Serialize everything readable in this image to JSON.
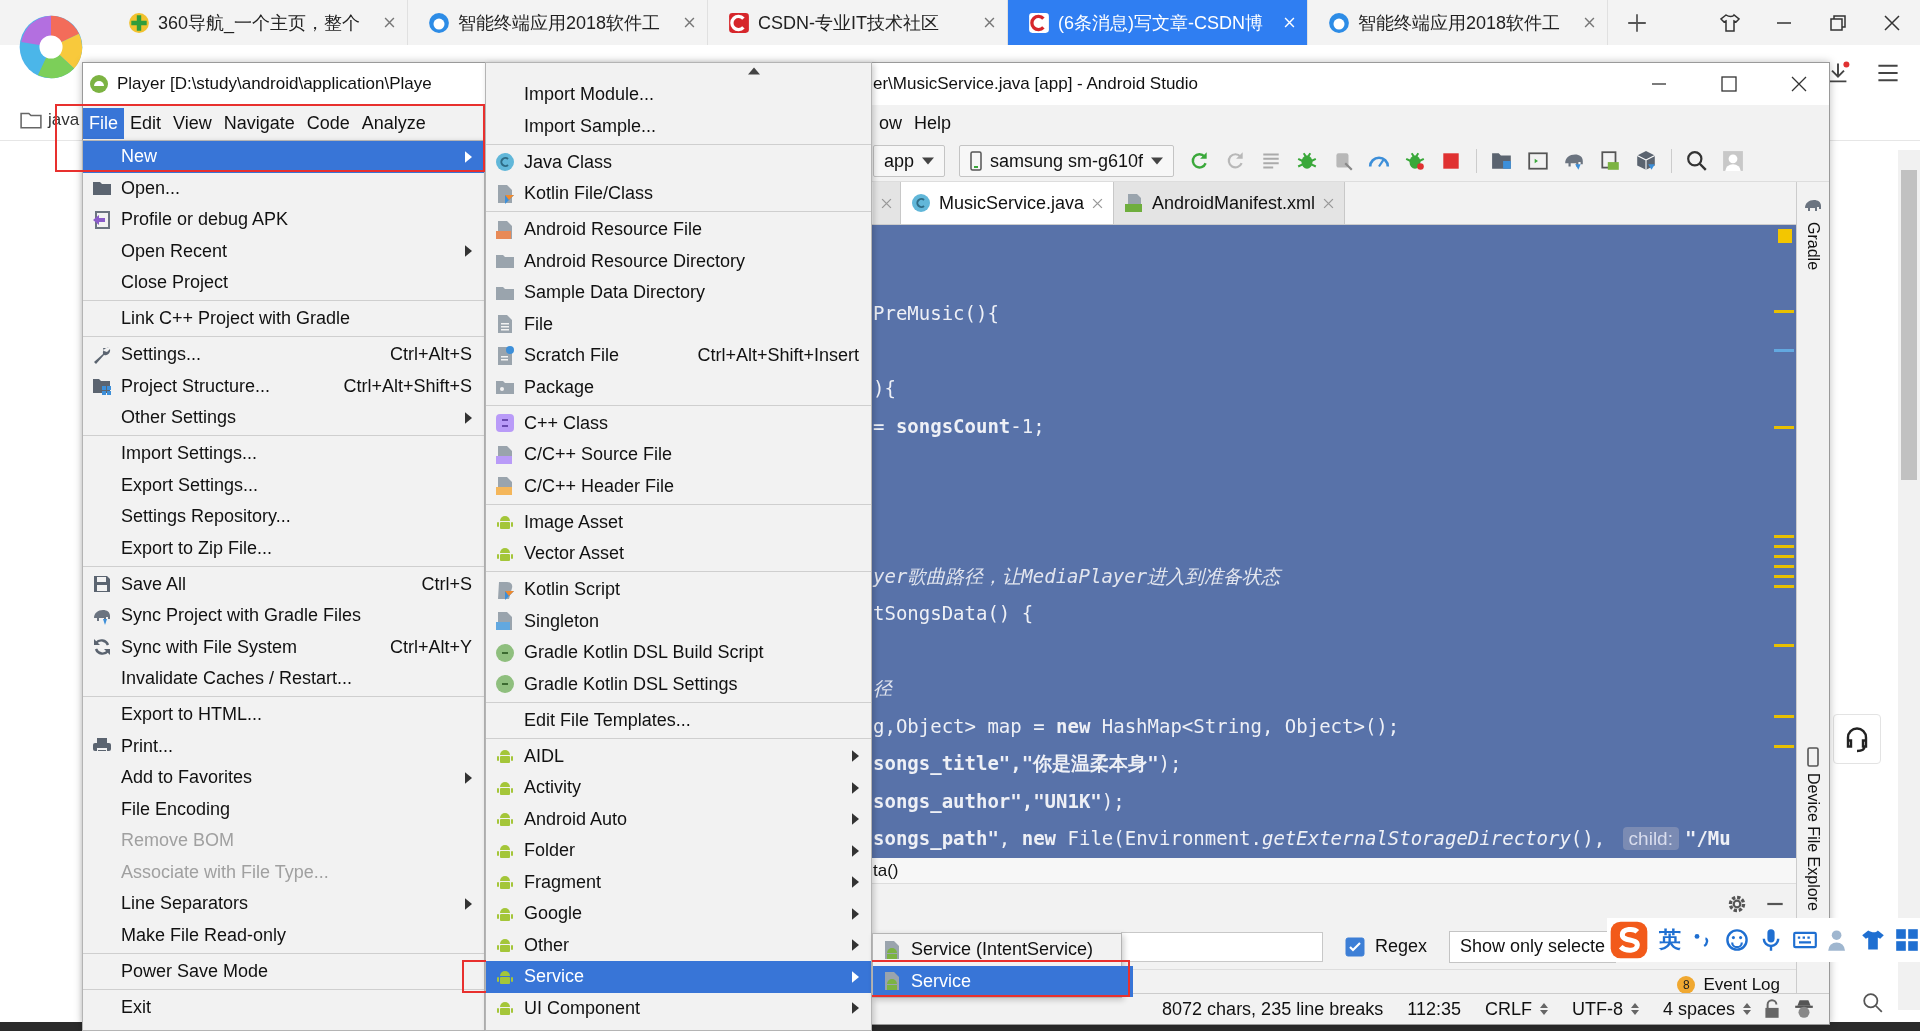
{
  "browser": {
    "tabs": [
      {
        "label": "360导航_一个主页，整个",
        "selected": false
      },
      {
        "label": "智能终端应用2018软件工",
        "selected": false
      },
      {
        "label": "CSDN-专业IT技术社区",
        "selected": false
      },
      {
        "label": "(6条消息)写文章-CSDN博",
        "selected": true
      },
      {
        "label": "智能终端应用2018软件工",
        "selected": false
      }
    ],
    "bookmark": "java"
  },
  "ide": {
    "title_left": "Player [D:\\study\\android\\application\\Playe",
    "title_right": "er\\MusicService.java [app] - Android Studio",
    "menubar": [
      {
        "label": "File",
        "selected": true
      },
      {
        "label": "Edit",
        "selected": false
      },
      {
        "label": "View",
        "selected": false
      },
      {
        "label": "Navigate",
        "selected": false
      },
      {
        "label": "Code",
        "selected": false
      },
      {
        "label": "Analyze",
        "selected": false
      }
    ],
    "menubar_right": [
      "ow",
      "Help"
    ],
    "run_config": "app",
    "device": "samsung sm-g610f",
    "editor_tabs": [
      {
        "label": "MusicService.java",
        "selected": true
      },
      {
        "label": "AndroidManifest.xml",
        "selected": false
      }
    ],
    "code_lines": [
      {
        "kind": "code",
        "text": "PreMusic(){"
      },
      {
        "kind": "blank"
      },
      {
        "kind": "code",
        "text": "){"
      },
      {
        "kind": "code",
        "text": "= **songsCount**-1;"
      },
      {
        "kind": "blank"
      },
      {
        "kind": "blank"
      },
      {
        "kind": "blank"
      },
      {
        "kind": "comment",
        "text": "yer歌曲路径，让MediaPlayer进入到准备状态"
      },
      {
        "kind": "code",
        "text": "tSongsData() {"
      },
      {
        "kind": "blank"
      },
      {
        "kind": "comment",
        "text": "径"
      },
      {
        "kind": "code",
        "text": "g,Object> map = **new** HashMap<String, Object>();"
      },
      {
        "kind": "code",
        "text": "**songs_title\",\"你是温柔本身\"**);"
      },
      {
        "kind": "code",
        "text": "**songs_author\",\"UN1K\"**);"
      },
      {
        "kind": "hinted",
        "text": "**songs_path\"**, **new** File(Environment.*getExternalStorageDirectory*(), ",
        "hint": "child:",
        "after": "**\"/Mu**"
      }
    ],
    "breadcrumb": "ta()",
    "filter": {
      "regex": {
        "label": "Regex",
        "checked": true
      },
      "dropdown": "Show only selecte"
    },
    "event_log": {
      "badge": "8",
      "label": "Event Log"
    },
    "status": [
      "8072 chars, 235 line breaks",
      "112:35",
      "CRLF",
      "UTF-8",
      "4 spaces"
    ],
    "status_switchable": [
      false,
      false,
      true,
      true,
      true
    ],
    "tool_windows": [
      "Gradle",
      "Device File Explore"
    ]
  },
  "file_menu": {
    "sections": [
      [
        {
          "label": "New",
          "selected": true,
          "submenu": true
        },
        {
          "label": "Open...",
          "selected": false
        },
        {
          "label": "Profile or debug APK",
          "selected": false
        },
        {
          "label": "Open Recent",
          "selected": false,
          "submenu": true
        },
        {
          "label": "Close Project",
          "selected": false
        }
      ],
      [
        {
          "label": "Link C++ Project with Gradle",
          "selected": false
        }
      ],
      [
        {
          "label": "Settings...",
          "selected": false,
          "shortcut": "Ctrl+Alt+S"
        },
        {
          "label": "Project Structure...",
          "selected": false,
          "shortcut": "Ctrl+Alt+Shift+S"
        },
        {
          "label": "Other Settings",
          "selected": false,
          "submenu": true
        }
      ],
      [
        {
          "label": "Import Settings...",
          "selected": false
        },
        {
          "label": "Export Settings...",
          "selected": false
        },
        {
          "label": "Settings Repository...",
          "selected": false
        },
        {
          "label": "Export to Zip File...",
          "selected": false
        }
      ],
      [
        {
          "label": "Save All",
          "selected": false,
          "shortcut": "Ctrl+S"
        },
        {
          "label": "Sync Project with Gradle Files",
          "selected": false
        },
        {
          "label": "Sync with File System",
          "selected": false,
          "shortcut": "Ctrl+Alt+Y"
        },
        {
          "label": "Invalidate Caches / Restart...",
          "selected": false
        }
      ],
      [
        {
          "label": "Export to HTML...",
          "selected": false
        },
        {
          "label": "Print...",
          "selected": false
        },
        {
          "label": "Add to Favorites",
          "selected": false,
          "submenu": true
        },
        {
          "label": "File Encoding",
          "selected": false
        },
        {
          "label": "Remove BOM",
          "selected": false,
          "disabled": true
        },
        {
          "label": "Associate with File Type...",
          "selected": false,
          "disabled": true
        },
        {
          "label": "Line Separators",
          "selected": false,
          "submenu": true
        },
        {
          "label": "Make File Read-only",
          "selected": false
        }
      ],
      [
        {
          "label": "Power Save Mode",
          "selected": false
        }
      ],
      [
        {
          "label": "Exit",
          "selected": false
        }
      ]
    ]
  },
  "new_menu": {
    "sections": [
      [
        {
          "label": "Import Module...",
          "selected": false
        },
        {
          "label": "Import Sample...",
          "selected": false
        }
      ],
      [
        {
          "label": "Java Class",
          "selected": false
        },
        {
          "label": "Kotlin File/Class",
          "selected": false
        }
      ],
      [
        {
          "label": "Android Resource File",
          "selected": false
        },
        {
          "label": "Android Resource Directory",
          "selected": false
        },
        {
          "label": "Sample Data Directory",
          "selected": false
        },
        {
          "label": "File",
          "selected": false
        },
        {
          "label": "Scratch File",
          "selected": false,
          "shortcut": "Ctrl+Alt+Shift+Insert"
        },
        {
          "label": "Package",
          "selected": false
        }
      ],
      [
        {
          "label": "C++ Class",
          "selected": false
        },
        {
          "label": "C/C++ Source File",
          "selected": false
        },
        {
          "label": "C/C++ Header File",
          "selected": false
        }
      ],
      [
        {
          "label": "Image Asset",
          "selected": false
        },
        {
          "label": "Vector Asset",
          "selected": false
        }
      ],
      [
        {
          "label": "Kotlin Script",
          "selected": false
        },
        {
          "label": "Singleton",
          "selected": false
        },
        {
          "label": "Gradle Kotlin DSL Build Script",
          "selected": false
        },
        {
          "label": "Gradle Kotlin DSL Settings",
          "selected": false
        }
      ],
      [
        {
          "label": "Edit File Templates...",
          "selected": false
        }
      ],
      [
        {
          "label": "AIDL",
          "selected": false,
          "submenu": true
        },
        {
          "label": "Activity",
          "selected": false,
          "submenu": true
        },
        {
          "label": "Android Auto",
          "selected": false,
          "submenu": true
        },
        {
          "label": "Folder",
          "selected": false,
          "submenu": true
        },
        {
          "label": "Fragment",
          "selected": false,
          "submenu": true
        },
        {
          "label": "Google",
          "selected": false,
          "submenu": true
        },
        {
          "label": "Other",
          "selected": false,
          "submenu": true
        },
        {
          "label": "Service",
          "selected": true,
          "submenu": true
        },
        {
          "label": "UI Component",
          "selected": false,
          "submenu": true
        }
      ]
    ]
  },
  "service_menu": {
    "items": [
      {
        "label": "Service (IntentService)",
        "selected": false
      },
      {
        "label": "Service",
        "selected": true
      }
    ]
  },
  "ime_toolbar": {
    "language": "英"
  }
}
